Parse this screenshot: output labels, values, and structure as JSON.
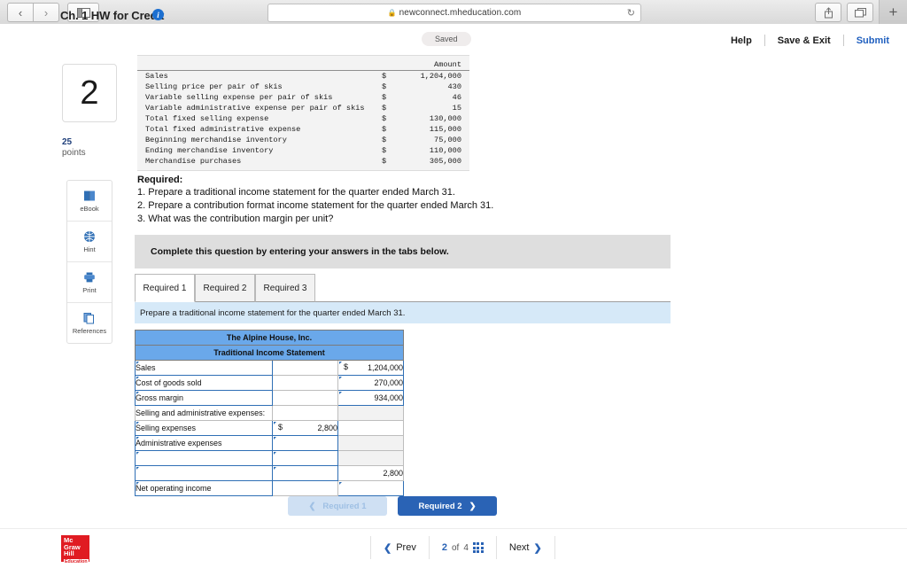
{
  "browser": {
    "url": "newconnect.mheducation.com",
    "back_icon": "chevron-left-icon",
    "forward_icon": "chevron-right-icon",
    "sidebar_icon": "sidebar-toggle-icon",
    "reload_icon": "reload-icon",
    "share_icon": "share-icon",
    "tabs_icon": "show-tabs-icon",
    "new_tab_label": "+"
  },
  "header": {
    "title": "Ch. 1 HW for Credit",
    "info_icon": "info-icon",
    "saved_label": "Saved",
    "links": [
      {
        "label": "Help"
      },
      {
        "label": "Save & Exit"
      },
      {
        "label": "Submit"
      }
    ]
  },
  "sidebar": {
    "question_number": "2",
    "points_value": "25",
    "points_label": "points",
    "tools": [
      {
        "label": "eBook",
        "icon": "book-icon"
      },
      {
        "label": "Hint",
        "icon": "hint-globe-icon"
      },
      {
        "label": "Print",
        "icon": "printer-icon"
      },
      {
        "label": "References",
        "icon": "copy-pages-icon"
      }
    ]
  },
  "given_data": {
    "column_header": "Amount",
    "rows": [
      {
        "label": "Sales",
        "currency": "$",
        "amount": "1,204,000"
      },
      {
        "label": "Selling price per pair of skis",
        "currency": "$",
        "amount": "430"
      },
      {
        "label": "Variable selling expense per pair of skis",
        "currency": "$",
        "amount": "46"
      },
      {
        "label": "Variable administrative expense per pair of skis",
        "currency": "$",
        "amount": "15"
      },
      {
        "label": "Total fixed selling expense",
        "currency": "$",
        "amount": "130,000"
      },
      {
        "label": "Total fixed administrative expense",
        "currency": "$",
        "amount": "115,000"
      },
      {
        "label": "Beginning merchandise inventory",
        "currency": "$",
        "amount": "75,000"
      },
      {
        "label": "Ending merchandise inventory",
        "currency": "$",
        "amount": "110,000"
      },
      {
        "label": "Merchandise purchases",
        "currency": "$",
        "amount": "305,000"
      }
    ]
  },
  "required": {
    "heading": "Required:",
    "items": [
      "1. Prepare a traditional income statement for the quarter ended March 31.",
      "2. Prepare a contribution format income statement for the quarter ended March 31.",
      "3. What was the contribution margin per unit?"
    ]
  },
  "instruction_banner": "Complete this question by entering your answers in the tabs below.",
  "tabs": [
    {
      "label": "Required 1",
      "active": true
    },
    {
      "label": "Required 2",
      "active": false
    },
    {
      "label": "Required 3",
      "active": false
    }
  ],
  "sub_instruction": "Prepare a traditional income statement for the quarter ended March 31.",
  "worksheet": {
    "company": "The Alpine House, Inc.",
    "statement_title": "Traditional Income Statement",
    "rows": [
      {
        "label": "Sales",
        "col2_currency": "",
        "col2": "",
        "col3_currency": "$",
        "col3": "1,204,000"
      },
      {
        "label": "Cost of goods sold",
        "col2_currency": "",
        "col2": "",
        "col3_currency": "",
        "col3": "270,000"
      },
      {
        "label": "Gross margin",
        "col2_currency": "",
        "col2": "",
        "col3_currency": "",
        "col3": "934,000"
      },
      {
        "label": "Selling and administrative expenses:",
        "col2_currency": "",
        "col2": "",
        "col3_currency": "",
        "col3": ""
      },
      {
        "label": "Selling expenses",
        "col2_currency": "$",
        "col2": "2,800",
        "col3_currency": "",
        "col3": ""
      },
      {
        "label": "Administrative expenses",
        "col2_currency": "",
        "col2": "",
        "col3_currency": "",
        "col3": ""
      },
      {
        "label": "",
        "col2_currency": "",
        "col2": "",
        "col3_currency": "",
        "col3": ""
      },
      {
        "label": "",
        "col2_currency": "",
        "col2": "",
        "col3_currency": "",
        "col3": "2,800"
      },
      {
        "label": "Net operating income",
        "col2_currency": "",
        "col2": "",
        "col3_currency": "",
        "col3": ""
      }
    ]
  },
  "pager_buttons": {
    "prev_label": "Required 1",
    "next_label": "Required 2",
    "prev_icon": "chevron-left-icon",
    "next_icon": "chevron-right-icon"
  },
  "footer": {
    "logo_line1": "Mc",
    "logo_line2": "Graw",
    "logo_line3": "Hill",
    "logo_line4": "Education",
    "prev_label": "Prev",
    "next_label": "Next",
    "page_current": "2",
    "page_of": "of",
    "page_total": "4",
    "grid_icon": "grid-view-icon"
  }
}
